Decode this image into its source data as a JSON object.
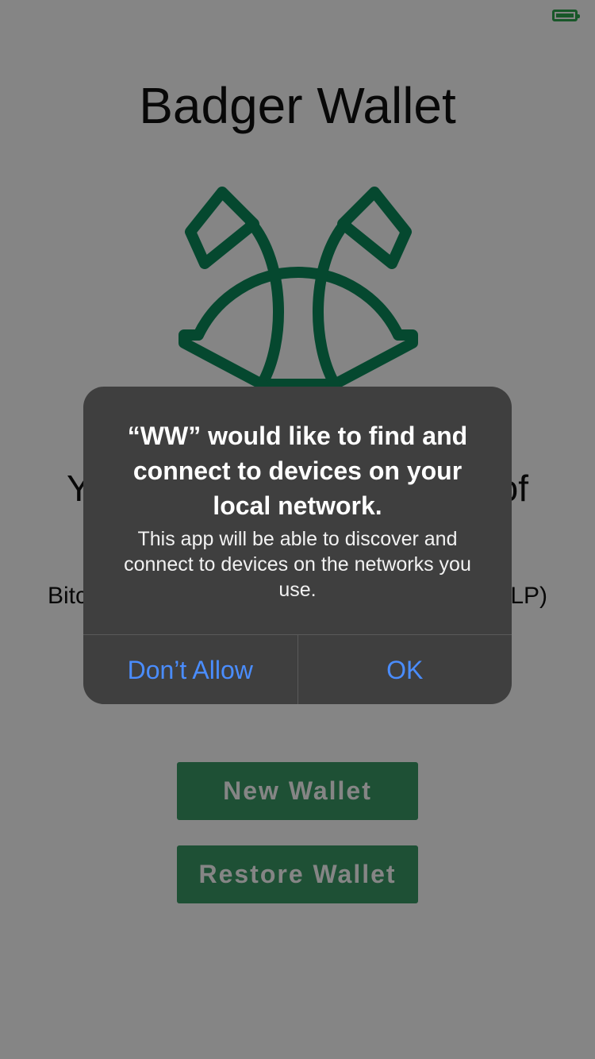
{
  "status_bar": {
    "battery_icon": "battery-icon",
    "battery_color": "#2fa84f"
  },
  "app": {
    "title": "Badger Wallet",
    "logo_icon": "badger-logo-icon",
    "logo_color": "#0a8a5a",
    "tagline": "Y",
    "tagline_end": "of",
    "subline_start": "Bitc",
    "subline_end": "LP)"
  },
  "buttons": {
    "new_wallet": "New Wallet",
    "restore_wallet": "Restore Wallet",
    "color": "#3a9a66"
  },
  "alert": {
    "title": "“WW” would like to find and connect to devices on your local network.",
    "message": "This app will be able to discover and connect to devices on the networks you use.",
    "dont_allow": "Don’t Allow",
    "ok": "OK",
    "accent_color": "#4a8dff"
  }
}
